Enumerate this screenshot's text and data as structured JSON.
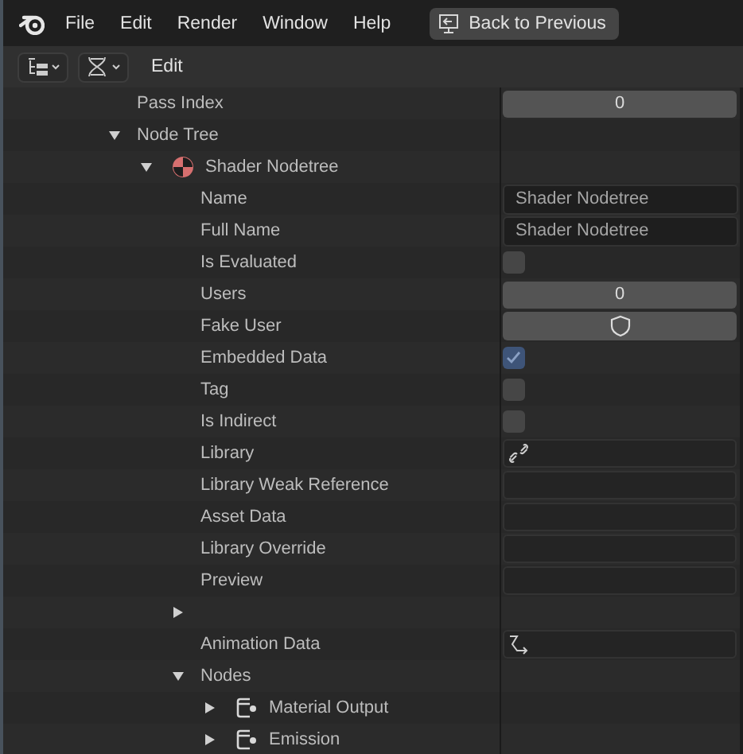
{
  "menu": [
    "File",
    "Edit",
    "Render",
    "Window",
    "Help"
  ],
  "back_button": {
    "label": "Back to Previous"
  },
  "header": {
    "label": "Edit"
  },
  "tree": [
    {
      "label": "Pass Index",
      "kind": "number",
      "value": "0"
    },
    {
      "label": "Node Tree",
      "kind": "none",
      "expanded": true,
      "children": [
        {
          "label": "Shader Nodetree",
          "kind": "shader",
          "expanded": true,
          "children": [
            {
              "label": "Name",
              "kind": "text",
              "value": "Shader Nodetree"
            },
            {
              "label": "Full Name",
              "kind": "text",
              "value": "Shader Nodetree"
            },
            {
              "label": "Is Evaluated",
              "kind": "checkbox",
              "checked": false
            },
            {
              "label": "Users",
              "kind": "number",
              "value": "0"
            },
            {
              "label": "Fake User",
              "kind": "toggle",
              "on": false
            },
            {
              "label": "Embedded Data",
              "kind": "checkbox",
              "checked": true
            },
            {
              "label": "Tag",
              "kind": "checkbox",
              "checked": false
            },
            {
              "label": "Is Indirect",
              "kind": "checkbox",
              "checked": false
            },
            {
              "label": "Library",
              "kind": "link"
            },
            {
              "label": "Library Weak Reference",
              "kind": "empty"
            },
            {
              "label": "Asset Data",
              "kind": "empty"
            },
            {
              "label": "Library Override",
              "kind": "empty"
            },
            {
              "label": "Preview",
              "kind": "empty"
            },
            {
              "kind": "none",
              "expanded": false
            },
            {
              "label": "Animation Data",
              "kind": "anim"
            },
            {
              "label": "Nodes",
              "kind": "none",
              "expanded": true,
              "children": [
                {
                  "label": "Material Output",
                  "kind": "node",
                  "expanded": false
                },
                {
                  "label": "Emission",
                  "kind": "node",
                  "expanded": false
                }
              ]
            }
          ]
        }
      ]
    }
  ]
}
